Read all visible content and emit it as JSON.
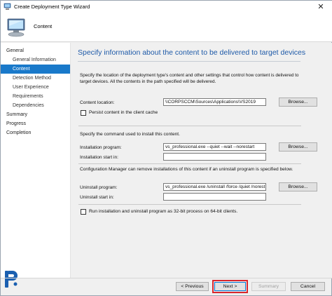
{
  "window": {
    "title": "Create Deployment Type Wizard",
    "close_glyph": "✕"
  },
  "header": {
    "page_name": "Content"
  },
  "nav": {
    "items": [
      {
        "label": "General",
        "level": "top",
        "active": false
      },
      {
        "label": "General Information",
        "level": "sub",
        "active": false
      },
      {
        "label": "Content",
        "level": "sub",
        "active": true
      },
      {
        "label": "Detection Method",
        "level": "sub",
        "active": false
      },
      {
        "label": "User Experience",
        "level": "sub",
        "active": false
      },
      {
        "label": "Requirements",
        "level": "sub",
        "active": false
      },
      {
        "label": "Dependencies",
        "level": "sub",
        "active": false
      },
      {
        "label": "Summary",
        "level": "top",
        "active": false
      },
      {
        "label": "Progress",
        "level": "top",
        "active": false
      },
      {
        "label": "Completion",
        "level": "top",
        "active": false
      }
    ]
  },
  "main": {
    "heading": "Specify information about the content to be delivered to target devices",
    "description": "Specify the location of the deployment type's content and other settings that control how content is delivered to target devices. All the contents in the path specified will be delivered.",
    "content_location": {
      "label": "Content location:",
      "value": "\\\\CORPSCCM\\Sources\\Applications\\VS2019",
      "browse": "Browse..."
    },
    "persist_content": {
      "label": "Persist content in the client cache",
      "checked": false
    },
    "install_intro": "Specify the command used to install this content.",
    "installation_program": {
      "label": "Installation program:",
      "value": "vs_professional.exe --quiet --wait --norestart",
      "browse": "Browse..."
    },
    "installation_start_in": {
      "label": "Installation start in:",
      "value": ""
    },
    "uninstall_intro": "Configuration Manager can remove installations of this content if an uninstall program is specified below.",
    "uninstall_program": {
      "label": "Uninstall program:",
      "value": "vs_professional.exe /uninstall /force /quiet /norest",
      "browse": "Browse..."
    },
    "uninstall_start_in": {
      "label": "Uninstall start in:",
      "value": ""
    },
    "run_32bit": {
      "label": "Run installation and uninstall program as 32-bit process on 64-bit clients.",
      "checked": false
    }
  },
  "footer": {
    "previous": "< Previous",
    "next": "Next >",
    "summary": "Summary",
    "cancel": "Cancel"
  },
  "colors": {
    "accent": "#1979ca",
    "heading": "#1e5aa8",
    "highlight": "#d9262c"
  }
}
